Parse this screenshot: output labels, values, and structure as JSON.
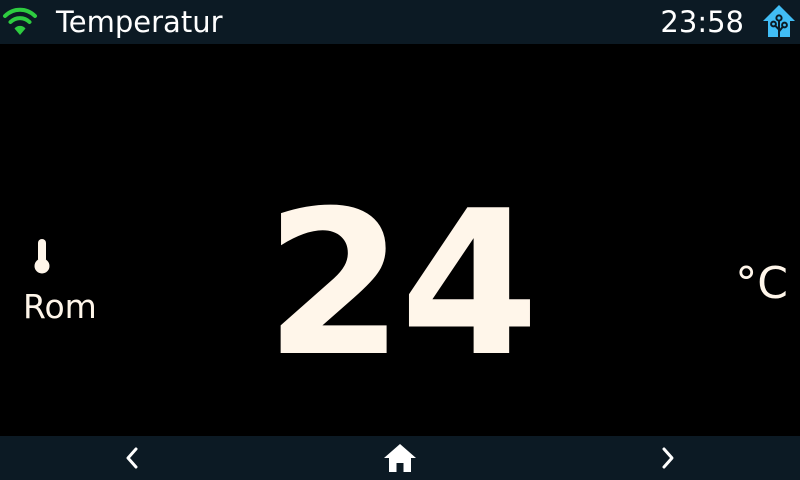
{
  "header": {
    "title": "Temperatur",
    "time": "23:58",
    "wifi_icon": "wifi-icon",
    "logo_icon": "home-assistant-icon"
  },
  "sensor": {
    "icon": "thermometer-icon",
    "label": "Rom",
    "value": "24",
    "unit": "°C"
  },
  "footer": {
    "prev_icon": "chevron-left-icon",
    "home_icon": "home-icon",
    "next_icon": "chevron-right-icon"
  },
  "colors": {
    "background": "#000000",
    "bar": "#0c1a24",
    "text": "#fff6ea",
    "wifi": "#2ecc40",
    "logo": "#41bdf5"
  }
}
